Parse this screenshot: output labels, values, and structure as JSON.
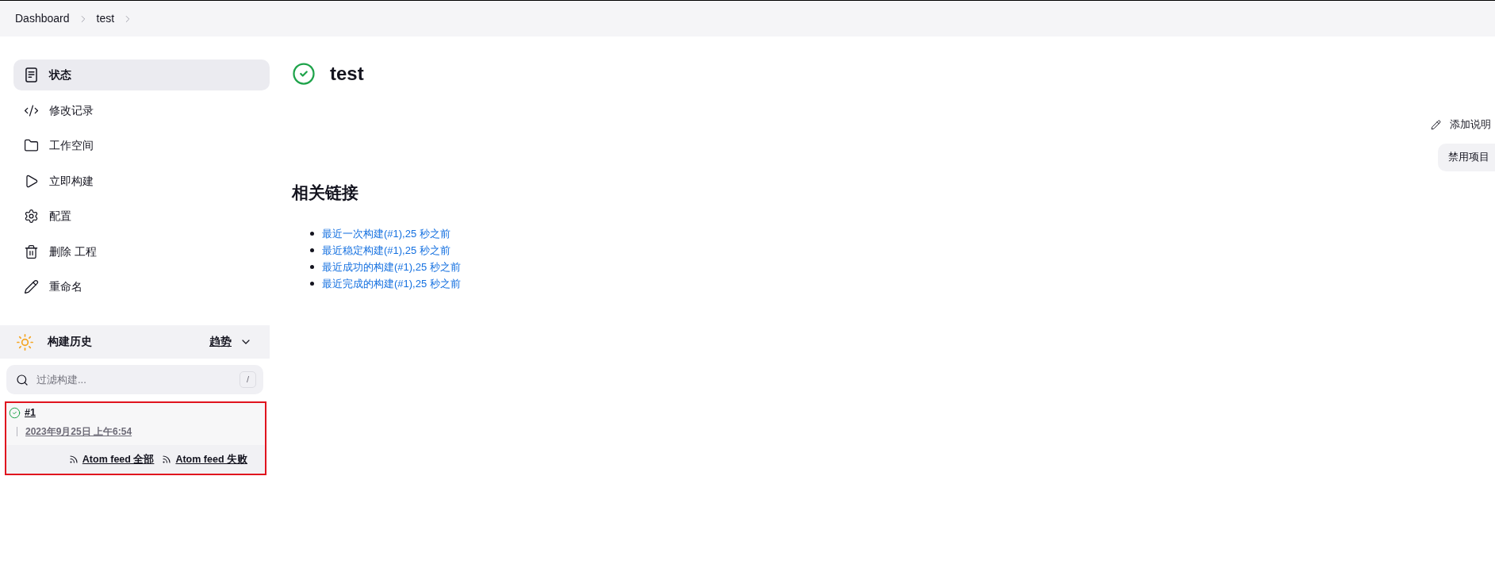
{
  "breadcrumb": [
    {
      "label": "Dashboard"
    },
    {
      "label": "test"
    }
  ],
  "sidebar": {
    "items": [
      {
        "label": "状态",
        "selected": true
      },
      {
        "label": "修改记录",
        "selected": false
      },
      {
        "label": "工作空间",
        "selected": false
      },
      {
        "label": "立即构建",
        "selected": false
      },
      {
        "label": "配置",
        "selected": false
      },
      {
        "label": "删除 工程",
        "selected": false
      },
      {
        "label": "重命名",
        "selected": false
      }
    ]
  },
  "build_history": {
    "title": "构建历史",
    "trend_link": "趋势",
    "filter": {
      "placeholder": "过滤构建...",
      "shortcut": "/"
    },
    "highlighted": true,
    "builds": [
      {
        "number": "#1",
        "date": "2023年9月25日 上午6:54",
        "successful": true
      }
    ],
    "feeds": [
      {
        "label": "Atom feed 全部"
      },
      {
        "label": "Atom feed 失败"
      }
    ]
  },
  "job": {
    "title": "test",
    "successful": true,
    "add_description": "添加说明",
    "disable_button": "禁用项目",
    "related_links": {
      "heading": "相关链接",
      "items": [
        {
          "label": "最近一次构建(#1),25 秒之前"
        },
        {
          "label": "最近稳定构建(#1),25 秒之前"
        },
        {
          "label": "最近成功的构建(#1),25 秒之前"
        },
        {
          "label": "最近完成的构建(#1),25 秒之前"
        }
      ]
    }
  }
}
